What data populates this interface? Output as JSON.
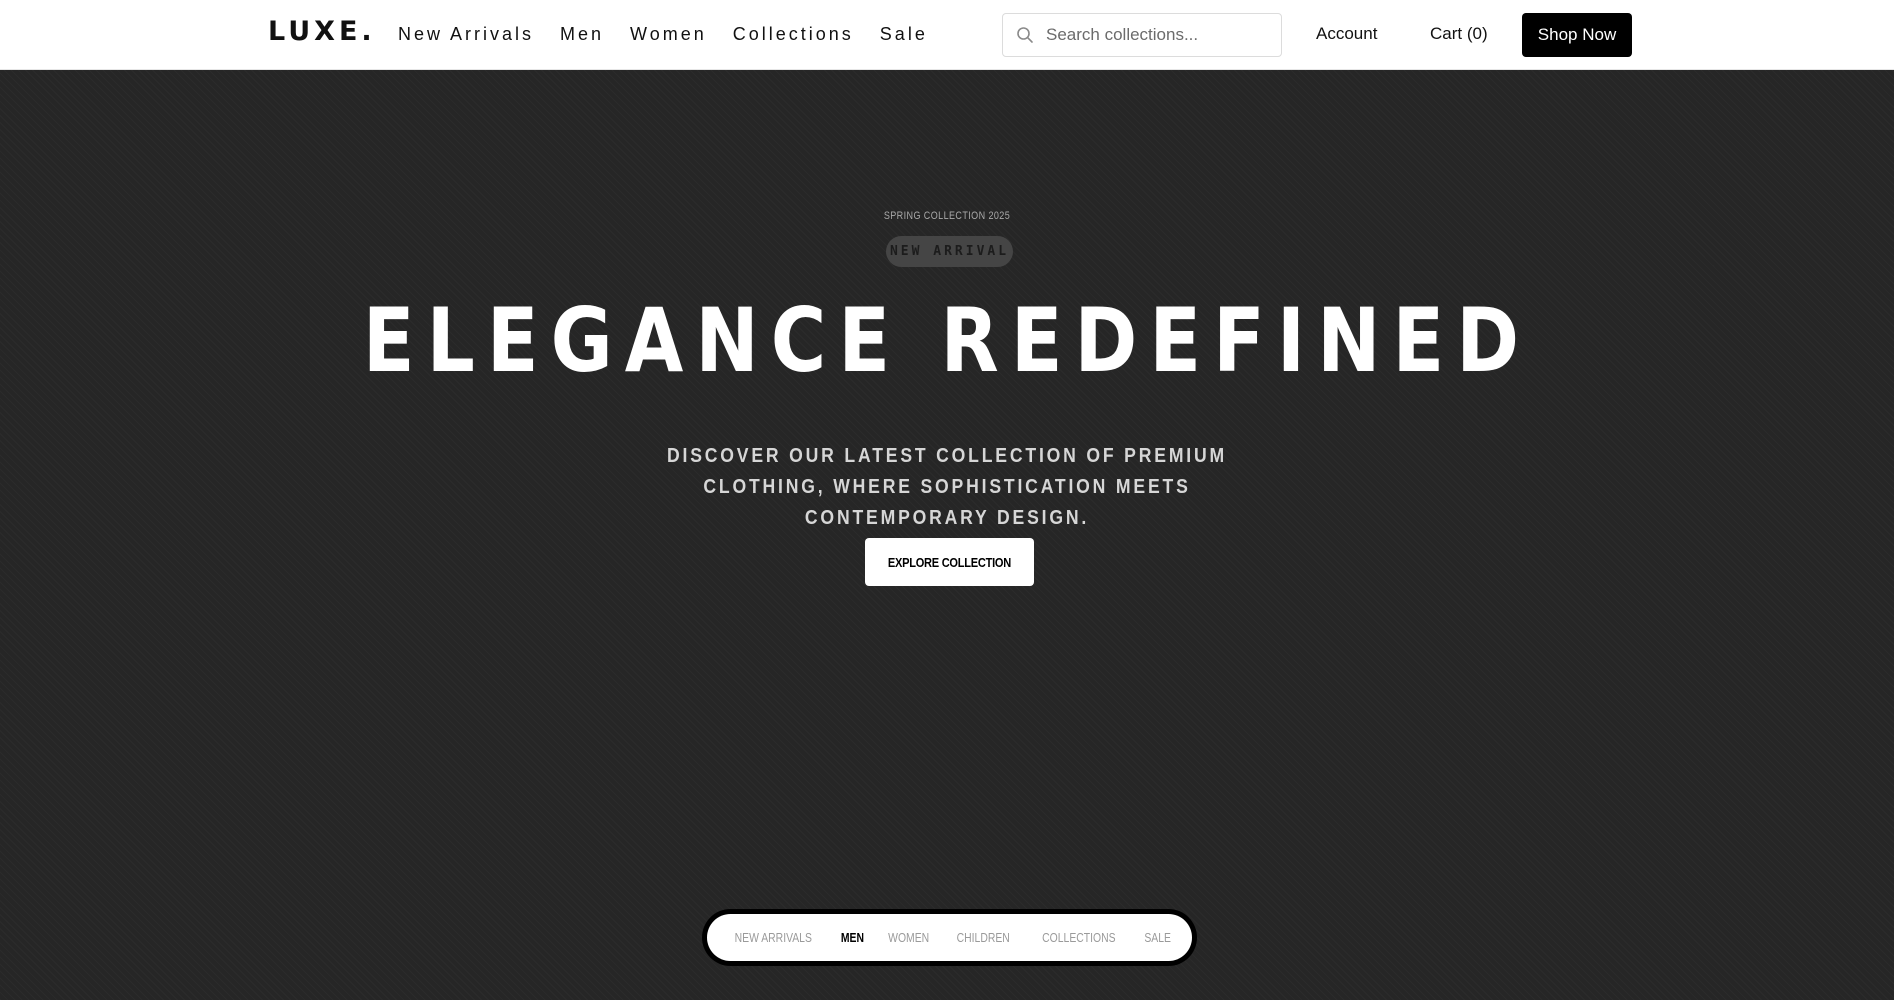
{
  "header": {
    "logo": "LUXE.",
    "nav": [
      "New Arrivals",
      "Men",
      "Women",
      "Collections",
      "Sale"
    ],
    "search": {
      "placeholder": "Search collections...",
      "value": ""
    },
    "account_label": "Account",
    "cart_label": "Cart (0)",
    "shop_label": "Shop Now"
  },
  "hero": {
    "eyebrow": "SPRING COLLECTION 2025",
    "badge": "NEW ARRIVAL",
    "title": "ELEGANCE REDEFINED",
    "subtitle": "DISCOVER OUR LATEST COLLECTION OF PREMIUM CLOTHING, WHERE SOPHISTICATION MEETS CONTEMPORARY DESIGN.",
    "cta_label": "EXPLORE COLLECTION"
  },
  "category_tabs": {
    "items": [
      "NEW ARRIVALS",
      "MEN",
      "WOMEN",
      "CHILDREN",
      "COLLECTIONS",
      "SALE"
    ],
    "active": "MEN"
  },
  "colors": {
    "nav_bg": "#ffffff",
    "hero_bg": "#262626",
    "accent": "#000000",
    "badge_bg": "#454545"
  },
  "icons": {
    "search": "search-icon"
  }
}
